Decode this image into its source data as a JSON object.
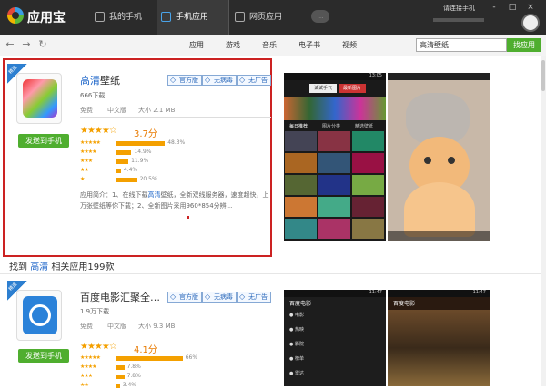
{
  "titlebar": {
    "brand": "应用宝",
    "tabs": [
      {
        "label": "我的手机"
      },
      {
        "label": "手机应用"
      },
      {
        "label": "网页应用"
      }
    ],
    "pill_text": "...",
    "device_status": "请连接手机",
    "window_buttons": [
      "-",
      "□",
      "×"
    ]
  },
  "nav": {
    "categories": [
      "应用",
      "游戏",
      "音乐",
      "电子书",
      "视频"
    ],
    "search_value": "高清壁纸",
    "search_button": "找应用"
  },
  "results": [
    {
      "ribbon": "精选",
      "title_prefix": "高清",
      "title_rest": "壁纸",
      "badges": [
        "官方版",
        "无病毒",
        "无广告"
      ],
      "downloads": "666下载",
      "meta": [
        "免费",
        "中文版",
        "大小 2.1 MB"
      ],
      "score": "3.7分",
      "ratings": [
        {
          "stars": "★★★★★",
          "pct": "48.3%",
          "fraction": 0.483
        },
        {
          "stars": "★★★★",
          "pct": "14.9%",
          "fraction": 0.149
        },
        {
          "stars": "★★★",
          "pct": "11.9%",
          "fraction": 0.119
        },
        {
          "stars": "★★",
          "pct": "4.4%",
          "fraction": 0.044
        },
        {
          "stars": "★",
          "pct": "20.5%",
          "fraction": 0.205
        }
      ],
      "desc_prefix": "应用简介：1、在线下载",
      "desc_hl": "高清",
      "desc_suffix": "壁纸，全新双线服务器，速度超快，上",
      "desc_line2": "万张壁纸等你下载；2、全新图片采用960*854分辨...",
      "send_button": "发送到手机",
      "screenshot1": {
        "tabs": [
          "试试手气",
          "最新图片",
          "每日推荐",
          "图片分类",
          "精选壁纸"
        ],
        "status": "13:05"
      },
      "screenshot2": {}
    },
    {
      "ribbon": "精选",
      "title_prefix": "",
      "title_rest": "百度电影汇聚全…",
      "badges": [
        "官方版",
        "无病毒",
        "无广告"
      ],
      "downloads": "1.9万下载",
      "meta": [
        "免费",
        "中文版",
        "大小 9.3 MB"
      ],
      "score": "4.1分",
      "ratings": [
        {
          "stars": "★★★★★",
          "pct": "66%",
          "fraction": 0.66
        },
        {
          "stars": "★★★★",
          "pct": "7.8%",
          "fraction": 0.078
        },
        {
          "stars": "★★★",
          "pct": "7.8%",
          "fraction": 0.078
        },
        {
          "stars": "★★",
          "pct": "3.4%",
          "fraction": 0.034
        }
      ],
      "send_button": "发送到手机",
      "screenshot1": {
        "title": "百度电影",
        "menu": [
          "电影",
          "热映",
          "影院",
          "榜单",
          "雷达"
        ],
        "status": "11:47"
      },
      "screenshot2": {
        "title": "百度电影",
        "status": "11:47"
      }
    }
  ],
  "found": {
    "prefix": "找到 ",
    "keyword": "高清",
    "suffix": " 相关应用199款"
  }
}
